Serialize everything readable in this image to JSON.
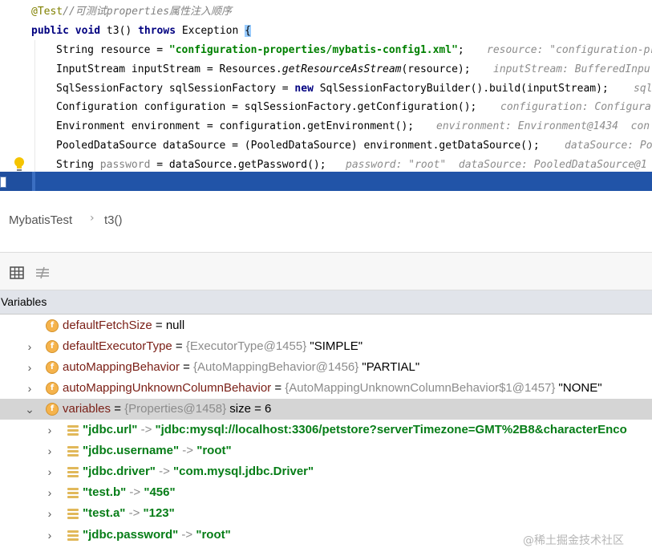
{
  "editor": {
    "comment": "@Test//可测试properties属性注入顺序",
    "lines": [
      {
        "pre": "public void ",
        "method": "t3",
        "mid": "() ",
        "kw2": "throws",
        "post": " Exception ",
        "brace": "{"
      },
      {
        "code": "String resource = ",
        "string": "\"configuration-properties/mybatis-config1.xml\"",
        "end": ";",
        "hint": "resource: \"configuration-pr"
      },
      {
        "code": "InputStream inputStream = Resources.",
        "method": "getResourceAsStream",
        "end": "(resource);",
        "hint": "inputStream: BufferedInpu"
      },
      {
        "code": "SqlSessionFactory sqlSessionFactory = ",
        "kw": "new",
        "end": " SqlSessionFactoryBuilder().build(inputStream);",
        "hint": "sql"
      },
      {
        "code": "Configuration configuration = sqlSessionFactory.getConfiguration();",
        "hint": "configuration: Configura"
      },
      {
        "code": "Environment environment = configuration.getEnvironment();",
        "hint": "environment: Environment@1434  con"
      },
      {
        "code": "PooledDataSource dataSource = (PooledDataSource) environment.getDataSource();",
        "hint": "dataSource: Po"
      },
      {
        "code": "String ",
        "unused": "password",
        "end": " = dataSource.getPassword();",
        "hint": "password: \"root\"  dataSource: PooledDataSource@1"
      }
    ]
  },
  "breadcrumb": {
    "class_name": "MybatisTest",
    "method_name": "t3()"
  },
  "toolbar": {
    "icons": [
      "table-icon",
      "settings-filter-icon"
    ]
  },
  "variables_panel": {
    "title": "Variables",
    "fields": [
      {
        "expand": "",
        "name": "defaultFetchSize",
        "eq": " = ",
        "type": "",
        "value": "null"
      },
      {
        "expand": "›",
        "name": "defaultExecutorType",
        "eq": " = ",
        "type": "{ExecutorType@1455}",
        "value": " \"SIMPLE\""
      },
      {
        "expand": "›",
        "name": "autoMappingBehavior",
        "eq": " = ",
        "type": "{AutoMappingBehavior@1456}",
        "value": " \"PARTIAL\""
      },
      {
        "expand": "›",
        "name": "autoMappingUnknownColumnBehavior",
        "eq": " = ",
        "type": "{AutoMappingUnknownColumnBehavior$1@1457}",
        "value": " \"NONE\""
      },
      {
        "expand": "⌄",
        "name": "variables",
        "eq": " = ",
        "type": "{Properties@1458}",
        "value": "  size = 6"
      }
    ],
    "entries": [
      {
        "key": "\"jdbc.url\"",
        "arrow": " -> ",
        "value": "\"jdbc:mysql://localhost:3306/petstore?serverTimezone=GMT%2B8&characterEnco"
      },
      {
        "key": "\"jdbc.username\"",
        "arrow": " -> ",
        "value": "\"root\""
      },
      {
        "key": "\"jdbc.driver\"",
        "arrow": " -> ",
        "value": "\"com.mysql.jdbc.Driver\""
      },
      {
        "key": "\"test.b\"",
        "arrow": " -> ",
        "value": "\"456\""
      },
      {
        "key": "\"test.a\"",
        "arrow": " -> ",
        "value": "\"123\""
      },
      {
        "key": "\"jdbc.password\"",
        "arrow": " -> ",
        "value": "\"root\""
      }
    ]
  },
  "watermark": "@稀土掘金技术社区"
}
